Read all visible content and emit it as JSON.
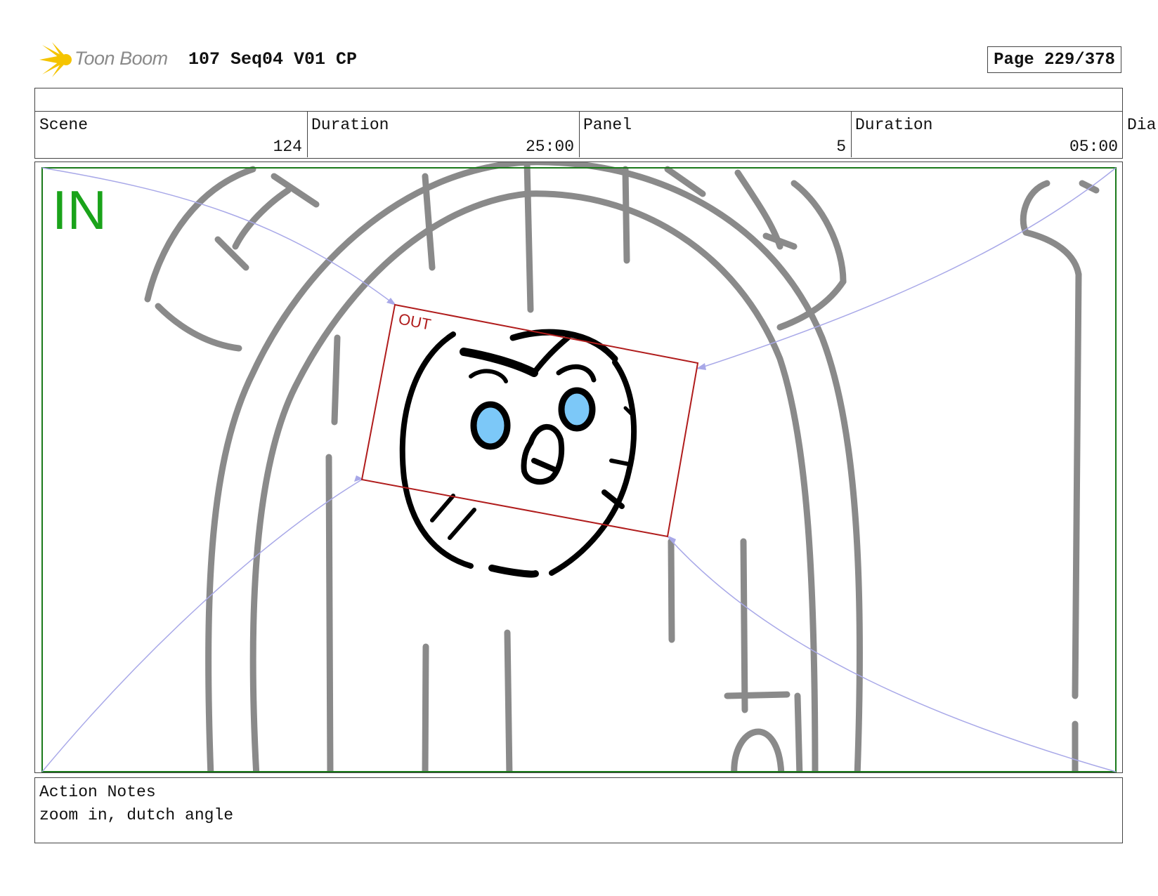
{
  "header": {
    "logo_text": "Toon Boom",
    "title": "107 Seq04 V01 CP",
    "page": "Page 229/378"
  },
  "info": {
    "scene_label": "Scene",
    "scene_value": "124",
    "scene_duration_label": "Duration",
    "scene_duration_value": "25:00",
    "panel_label": "Panel",
    "panel_value": "5",
    "panel_duration_label": "Duration",
    "panel_duration_value": "05:00",
    "dialogue_label": "Dia"
  },
  "frame": {
    "in_label": "IN",
    "out_label": "OUT"
  },
  "notes": {
    "label": "Action Notes",
    "text": "zoom in, dutch angle"
  },
  "colors": {
    "in_frame": "#1a7a1a",
    "in_label": "#1aa31a",
    "out_frame": "#b01c1c",
    "motion_path": "#a8a8e8",
    "sketch_gray": "#8a8a8a",
    "eye_fill": "#7cc8f8",
    "logo_yellow": "#f5c400"
  }
}
